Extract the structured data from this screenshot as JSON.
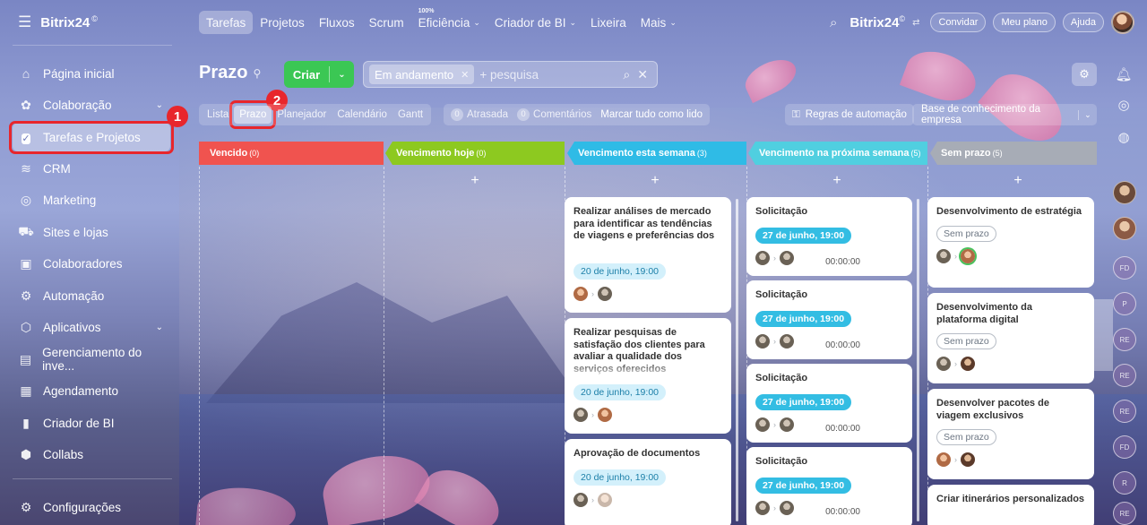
{
  "brand": {
    "name": "Bitrix24",
    "mark": "©"
  },
  "topnav": [
    {
      "label": "Tarefas"
    },
    {
      "label": "Projetos"
    },
    {
      "label": "Fluxos"
    },
    {
      "label": "Scrum"
    },
    {
      "label": "Eficiência",
      "sup": "100%"
    },
    {
      "label": "Criador de BI"
    },
    {
      "label": "Lixeira"
    },
    {
      "label": "Mais"
    }
  ],
  "header_right": {
    "brand": "Bitrix24",
    "mark": "©",
    "invite": "Convidar",
    "plan": "Meu plano",
    "help": "Ajuda"
  },
  "sidebar": {
    "items": [
      {
        "label": "Página inicial",
        "icon": "home-icon"
      },
      {
        "label": "Colaboração",
        "icon": "collab-icon"
      },
      {
        "label": "Tarefas e Projetos",
        "icon": "check-icon"
      },
      {
        "label": "CRM",
        "icon": "crm-icon"
      },
      {
        "label": "Marketing",
        "icon": "marketing-icon"
      },
      {
        "label": "Sites e lojas",
        "icon": "cart-icon"
      },
      {
        "label": "Colaboradores",
        "icon": "employees-icon"
      },
      {
        "label": "Automação",
        "icon": "automation-icon"
      },
      {
        "label": "Aplicativos",
        "icon": "apps-icon"
      },
      {
        "label": "Gerenciamento do inve...",
        "icon": "inventory-icon"
      },
      {
        "label": "Agendamento",
        "icon": "calendar-icon"
      },
      {
        "label": "Criador de BI",
        "icon": "bi-icon"
      },
      {
        "label": "Collabs",
        "icon": "collabs-icon"
      },
      {
        "label": "Configurações",
        "icon": "settings-icon"
      }
    ]
  },
  "callouts": [
    "1",
    "2"
  ],
  "page": {
    "title": "Prazo",
    "create": "Criar",
    "filter_chip": "Em andamento",
    "search_placeholder": "+ pesquisa"
  },
  "views": [
    "Lista",
    "Prazo",
    "Planejador",
    "Calendário",
    "Gantt"
  ],
  "counters": {
    "overdue_count": "0",
    "overdue_label": "Atrasada",
    "comments_count": "0",
    "comments_label": "Comentários",
    "mark_all": "Marcar tudo como lido"
  },
  "automation": "Regras de automação",
  "knowledge": "Base de conhecimento da empresa",
  "rail_avatars": [
    "FD",
    "P",
    "RE",
    "RE",
    "RE",
    "FD",
    "R",
    "RE"
  ],
  "columns": [
    {
      "title": "Vencido",
      "count": "(0)",
      "color": "#f0534f"
    },
    {
      "title": "Vencimento hoje",
      "count": "(0)",
      "color": "#8dc920"
    },
    {
      "title": "Vencimento esta semana",
      "count": "(3)",
      "color": "#2fbbe6"
    },
    {
      "title": "Vencimento na próxima semana",
      "count": "(5)",
      "color": "#50cfe0"
    },
    {
      "title": "Sem prazo",
      "count": "(5)",
      "color": "#a7acb6"
    }
  ],
  "cards_week": [
    {
      "title": "Realizar análises de mercado para identificar as tendências de viagens e preferências dos",
      "date": "20 de junho, 19:00"
    },
    {
      "title": "Realizar pesquisas de satisfação dos clientes para avaliar a qualidade dos serviços oferecidos",
      "date": "20 de junho, 19:00"
    },
    {
      "title": "Aprovação de documentos",
      "date": "20 de junho, 19:00"
    }
  ],
  "cards_next": [
    {
      "title": "Solicitação",
      "date": "27 de junho, 19:00",
      "time": "00:00:00"
    },
    {
      "title": "Solicitação",
      "date": "27 de junho, 19:00",
      "time": "00:00:00"
    },
    {
      "title": "Solicitação",
      "date": "27 de junho, 19:00",
      "time": "00:00:00"
    },
    {
      "title": "Solicitação",
      "date": "27 de junho, 19:00",
      "time": "00:00:00"
    }
  ],
  "cards_none": [
    {
      "title": "Desenvolvimento de estratégia",
      "chip": "Sem prazo"
    },
    {
      "title": "Desenvolvimento da plataforma digital",
      "chip": "Sem prazo"
    },
    {
      "title": "Desenvolver pacotes de viagem exclusivos",
      "chip": "Sem prazo"
    },
    {
      "title": "Criar itinerários personalizados"
    }
  ]
}
